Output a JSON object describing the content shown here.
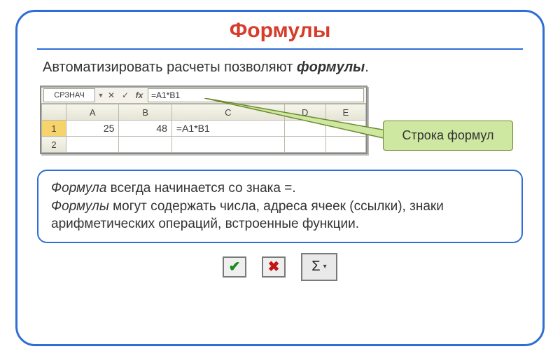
{
  "title": "Формулы",
  "intro_plain": "Автоматизировать расчеты позволяют ",
  "intro_keyword": "формулы",
  "intro_end": ".",
  "spreadsheet": {
    "name_box": "СРЗНАЧ",
    "formula_input": "=A1*B1",
    "columns": [
      "A",
      "B",
      "C",
      "D",
      "E"
    ],
    "rows": [
      {
        "n": "1",
        "cells": [
          "25",
          "48",
          "=A1*B1",
          "",
          ""
        ]
      },
      {
        "n": "2",
        "cells": [
          "",
          "",
          "",
          "",
          ""
        ]
      }
    ]
  },
  "callout": "Строка формул",
  "infobox": {
    "line1_keyword": "Формула",
    "line1_rest": " всегда начинается со знака =.",
    "line2_keyword": "Формулы",
    "line2_rest": " могут содержать числа, адреса ячеек (ссылки), знаки арифметических операций, встроенные функции."
  },
  "icons": {
    "check": "✔",
    "cross": "✖",
    "sigma": "Σ",
    "dropdown": "▾"
  }
}
